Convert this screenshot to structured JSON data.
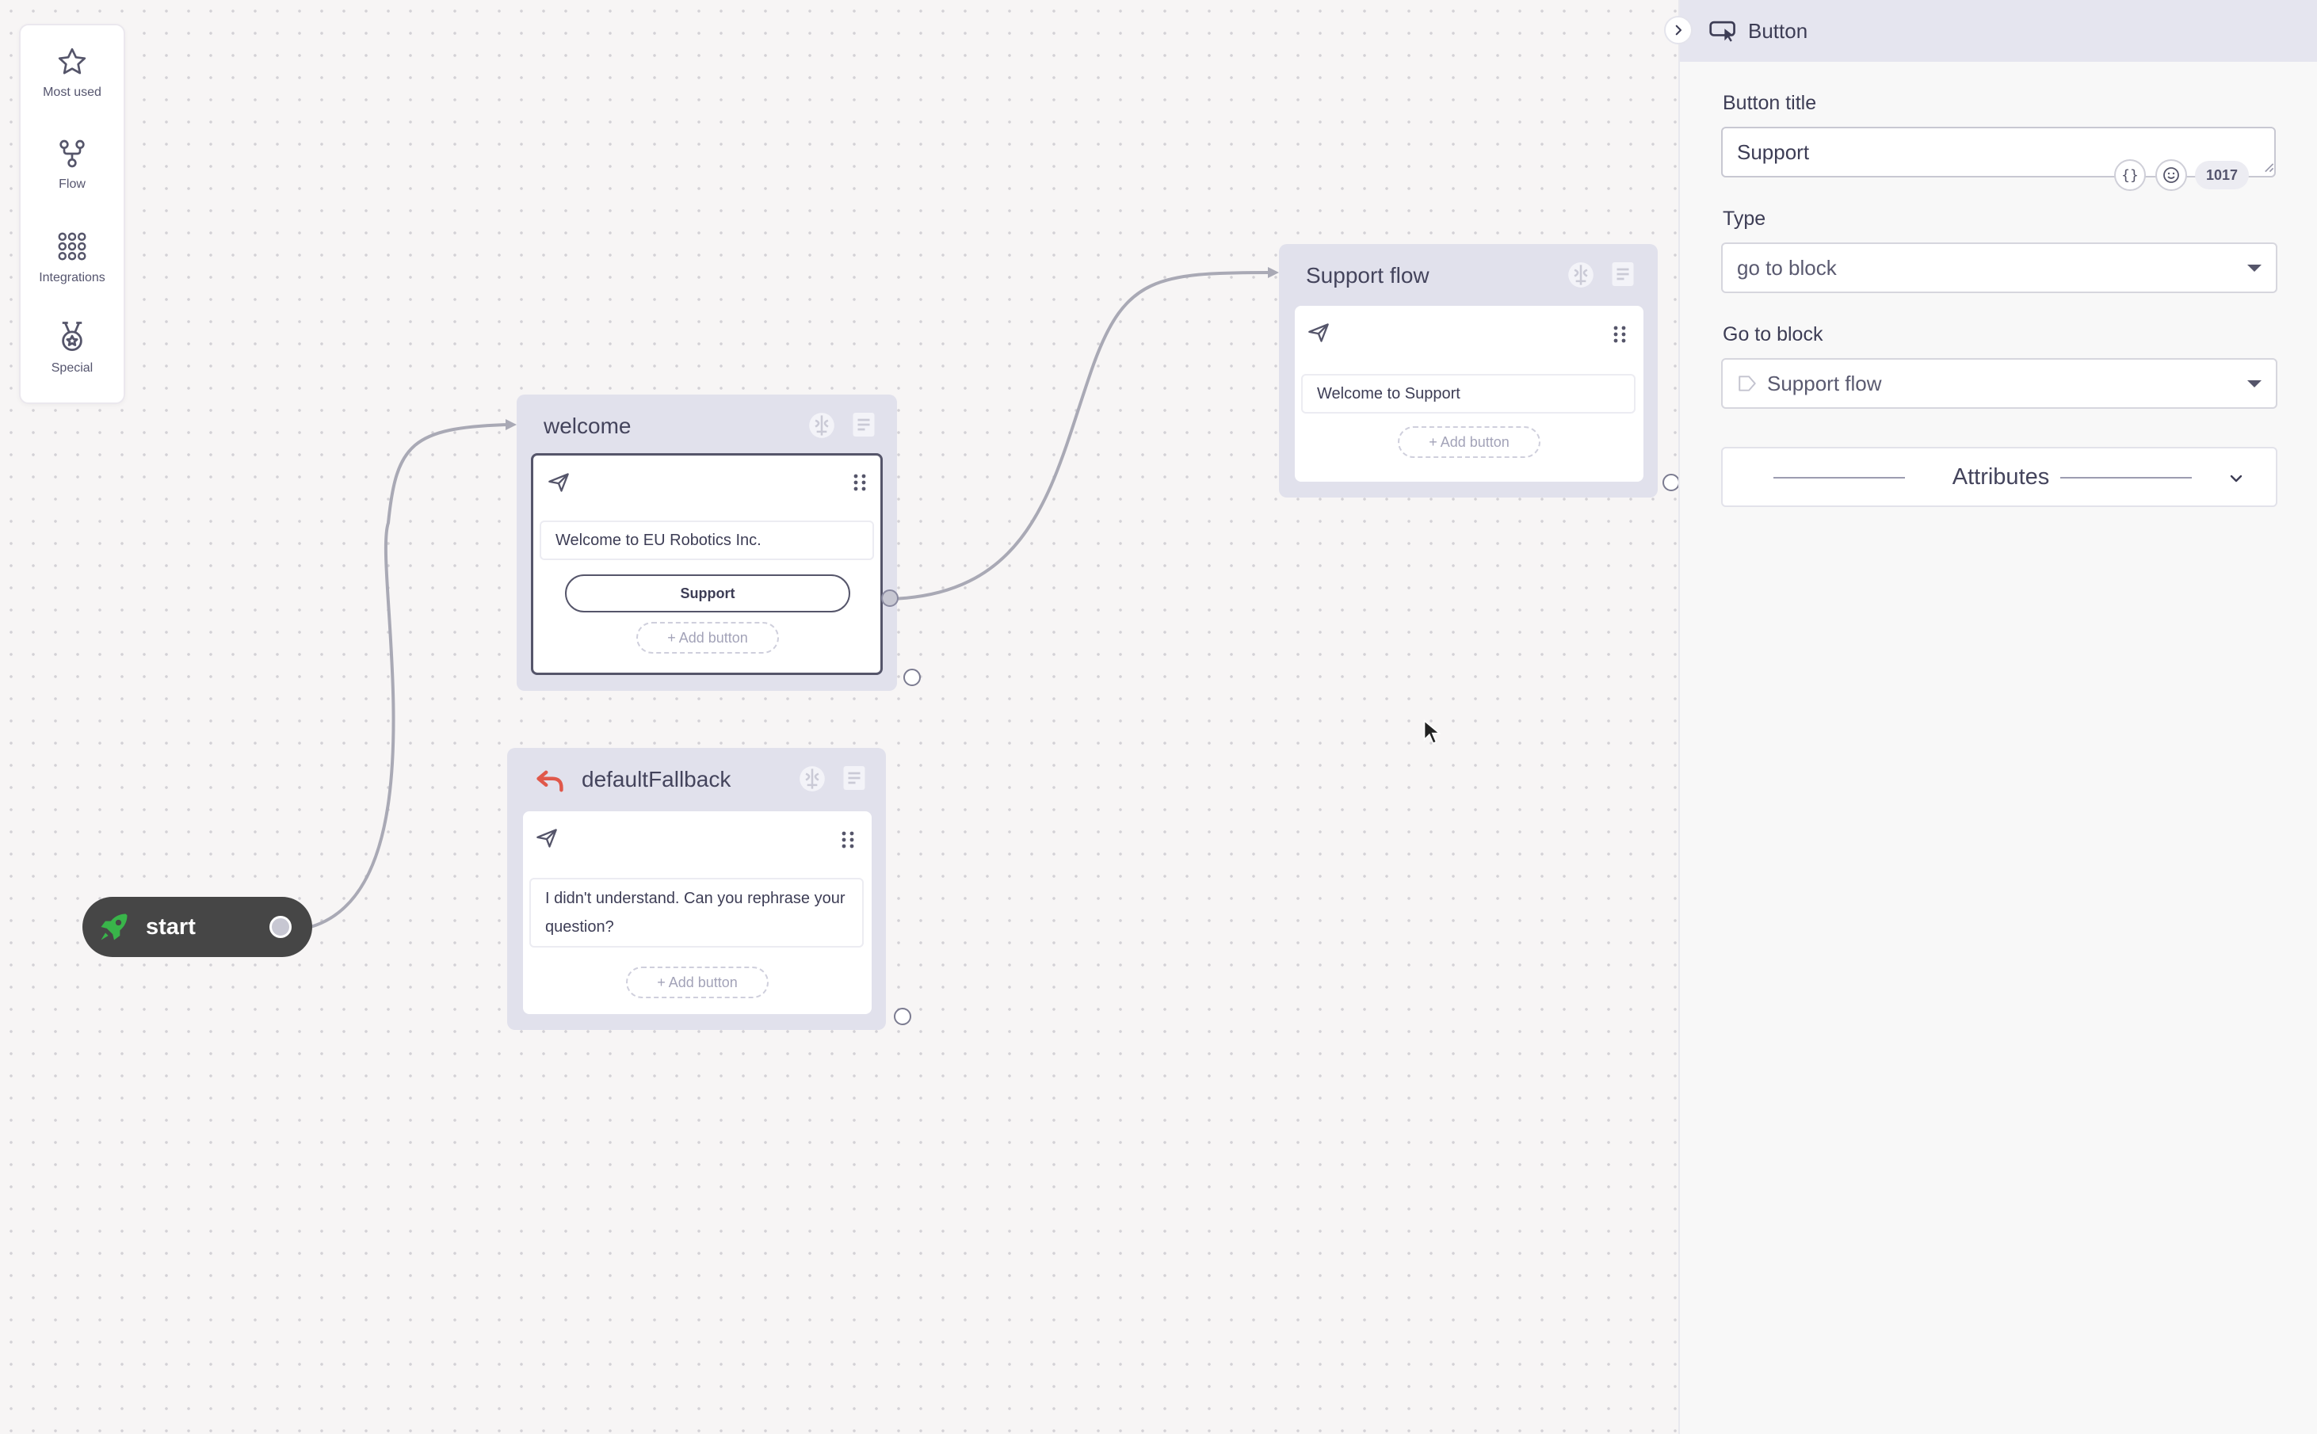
{
  "palette": {
    "items": [
      {
        "label": "Most used",
        "icon": "star-icon"
      },
      {
        "label": "Flow",
        "icon": "flow-icon"
      },
      {
        "label": "Integrations",
        "icon": "grid-icon"
      },
      {
        "label": "Special",
        "icon": "medal-icon"
      }
    ]
  },
  "blocks": {
    "welcome": {
      "title": "welcome",
      "message": "Welcome to EU Robotics Inc.",
      "button": "Support",
      "add_button": "+ Add button"
    },
    "support_flow": {
      "title": "Support flow",
      "message": "Welcome to Support",
      "add_button": "+ Add button"
    },
    "fallback": {
      "title": "defaultFallback",
      "message": "I didn't understand. Can you rephrase your question?",
      "add_button": "+ Add button"
    },
    "start": {
      "label": "start"
    }
  },
  "panel": {
    "header": "Button",
    "button_title_label": "Button title",
    "button_title_value": "Support",
    "counter": "1017",
    "type_label": "Type",
    "type_value": "go to block",
    "goto_label": "Go to block",
    "goto_value": "Support flow",
    "attributes_label": "Attributes"
  },
  "colors": {
    "accent": "#3d3d55",
    "block_bg": "#e1e1ec",
    "start_bg": "#464646",
    "start_icon": "#39b54a",
    "fallback_icon": "#e0584a"
  }
}
